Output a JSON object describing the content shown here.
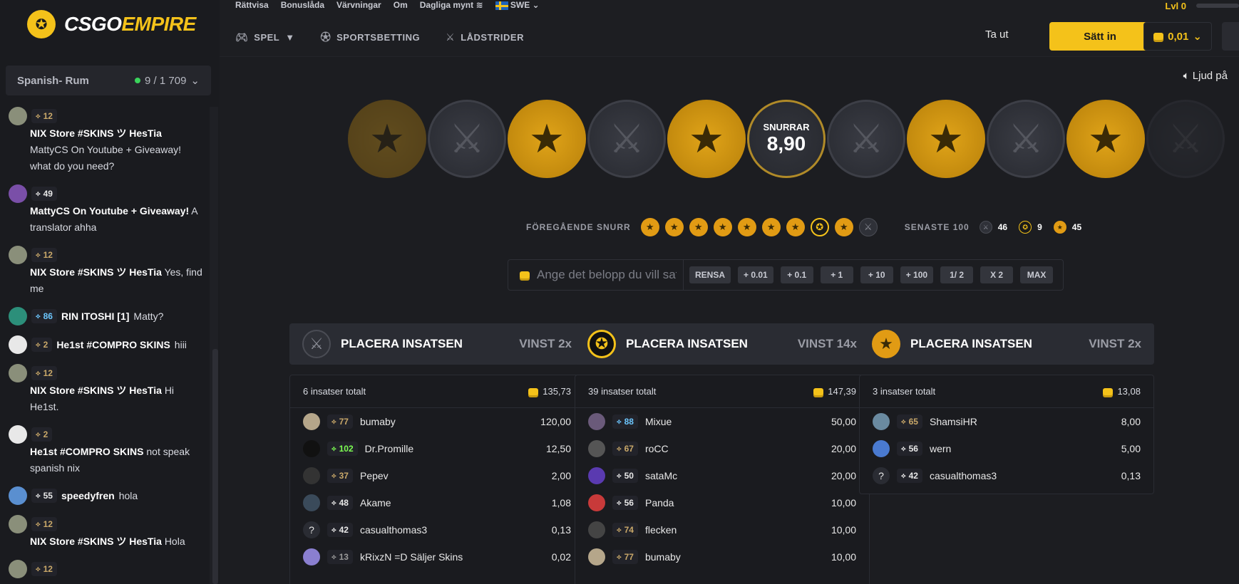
{
  "brand": {
    "csgo": "CSGO",
    "empire": "EMPIRE"
  },
  "colors": {
    "accent": "#f4c21a",
    "online": "#3ad35b",
    "bg": "#1d1e22"
  },
  "room": {
    "name": "Spanish- Rum",
    "count": "9 / 1 709"
  },
  "toplinks": [
    "Rättvisa",
    "Bonuslåda",
    "Värvningar",
    "Om",
    "Dagliga mynt",
    "SWE"
  ],
  "level": "Lvl 0",
  "nav": [
    {
      "label": "SPEL",
      "icon": "gamepad-icon"
    },
    {
      "label": "SPORTSBETTING",
      "icon": "ball-icon"
    },
    {
      "label": "LÅDSTRIDER",
      "icon": "swords-icon"
    }
  ],
  "header": {
    "withdraw": "Ta ut",
    "deposit": "Sätt in",
    "balance": "0,01"
  },
  "sound": "Ljud på",
  "wheel": {
    "label": "SNURRAR",
    "value": "8,90"
  },
  "previous": {
    "label": "FÖREGÅENDE SNURR",
    "spins": [
      "t",
      "t",
      "t",
      "t",
      "t",
      "t",
      "t",
      "bonus",
      "t",
      "ct"
    ],
    "last_label": "SENASTE 100",
    "ct_count": "46",
    "bonus_count": "9",
    "t_count": "45"
  },
  "bet": {
    "placeholder": "Ange det belopp du vill satsa",
    "buttons": [
      "RENSA",
      "+ 0.01",
      "+ 0.1",
      "+ 1",
      "+ 10",
      "+ 100",
      "1/ 2",
      "X 2",
      "MAX"
    ]
  },
  "chat": [
    {
      "level": "12",
      "lvl_class": "",
      "name": "NIX Store #SKINS ツ HesTia",
      "text": "MattyCS On Youtube + Giveaway! what do you need?",
      "avatar": "#8a8f7a",
      "layout": "block"
    },
    {
      "level": "49",
      "lvl_class": "white",
      "name": "MattyCS On Youtube + Giveaway!",
      "text": "A translator ahha",
      "avatar": "#7a4fa8",
      "layout": "block"
    },
    {
      "level": "12",
      "lvl_class": "",
      "name": "NIX Store #SKINS ツ HesTia",
      "text": "Yes, find me",
      "avatar": "#8a8f7a",
      "layout": "block"
    },
    {
      "level": "86",
      "lvl_class": "blue",
      "name": "RIN ITOSHI [1]",
      "text": "Matty?",
      "avatar": "#2c8f7a",
      "layout": "inline"
    },
    {
      "level": "2",
      "lvl_class": "",
      "name": "He1st #COMPRO SKINS",
      "text": "hiii",
      "avatar": "#e8e8e8",
      "layout": "inline"
    },
    {
      "level": "12",
      "lvl_class": "",
      "name": "NIX Store #SKINS ツ HesTia",
      "text": "Hi He1st.",
      "avatar": "#8a8f7a",
      "layout": "block"
    },
    {
      "level": "2",
      "lvl_class": "",
      "name": "He1st #COMPRO SKINS",
      "text": "not speak spanish nix",
      "avatar": "#e8e8e8",
      "layout": "block"
    },
    {
      "level": "55",
      "lvl_class": "white",
      "name": "speedyfren",
      "text": "hola",
      "avatar": "#5a8fd0",
      "layout": "inline"
    },
    {
      "level": "12",
      "lvl_class": "",
      "name": "NIX Store #SKINS ツ HesTia",
      "text": "Hola",
      "avatar": "#8a8f7a",
      "layout": "block"
    },
    {
      "level": "12",
      "lvl_class": "",
      "name": "",
      "text": "",
      "avatar": "#8a8f7a",
      "layout": "block"
    }
  ],
  "columns": [
    {
      "icon": "ct",
      "title": "PLACERA INSATSEN",
      "win": "VINST 2x",
      "total_label": "6 insatser totalt",
      "total": "135,73",
      "rows": [
        {
          "level": "77",
          "lvl_class": "",
          "name": "bumaby",
          "amount": "120,00",
          "avatar": "#b5a68a"
        },
        {
          "level": "102",
          "lvl_class": "green",
          "name": "Dr.Promille",
          "amount": "12,50",
          "avatar": "#111111"
        },
        {
          "level": "37",
          "lvl_class": "",
          "name": "Pepev",
          "amount": "2,00",
          "avatar": "#333333"
        },
        {
          "level": "48",
          "lvl_class": "white",
          "name": "Akame",
          "amount": "1,08",
          "avatar": "#3a4a5a"
        },
        {
          "level": "42",
          "lvl_class": "white",
          "name": "casualthomas3",
          "amount": "0,13",
          "avatar": "?"
        },
        {
          "level": "13",
          "lvl_class": "gray",
          "name": "kRixzN =D Säljer Skins",
          "amount": "0,02",
          "avatar": "#8a7fd0"
        }
      ]
    },
    {
      "icon": "bonus",
      "title": "PLACERA INSATSEN",
      "win": "VINST 14x",
      "total_label": "39 insatser totalt",
      "total": "147,39",
      "rows": [
        {
          "level": "88",
          "lvl_class": "blue",
          "name": "Mixue",
          "amount": "50,00",
          "avatar": "#6a5a7a"
        },
        {
          "level": "67",
          "lvl_class": "",
          "name": "roCC",
          "amount": "20,00",
          "avatar": "#555555"
        },
        {
          "level": "50",
          "lvl_class": "white",
          "name": "sataMc",
          "amount": "20,00",
          "avatar": "#5a3ab0"
        },
        {
          "level": "56",
          "lvl_class": "white",
          "name": "Panda",
          "amount": "10,00",
          "avatar": "#c83a3a"
        },
        {
          "level": "74",
          "lvl_class": "",
          "name": "flecken",
          "amount": "10,00",
          "avatar": "#444444"
        },
        {
          "level": "77",
          "lvl_class": "",
          "name": "bumaby",
          "amount": "10,00",
          "avatar": "#b5a68a"
        }
      ]
    },
    {
      "icon": "t",
      "title": "PLACERA INSATSEN",
      "win": "VINST 2x",
      "total_label": "3 insatser totalt",
      "total": "13,08",
      "rows": [
        {
          "level": "65",
          "lvl_class": "",
          "name": "ShamsiHR",
          "amount": "8,00",
          "avatar": "#6a8aa0"
        },
        {
          "level": "56",
          "lvl_class": "white",
          "name": "wern",
          "amount": "5,00",
          "avatar": "#4a7ad0"
        },
        {
          "level": "42",
          "lvl_class": "white",
          "name": "casualthomas3",
          "amount": "0,13",
          "avatar": "?"
        }
      ]
    }
  ]
}
